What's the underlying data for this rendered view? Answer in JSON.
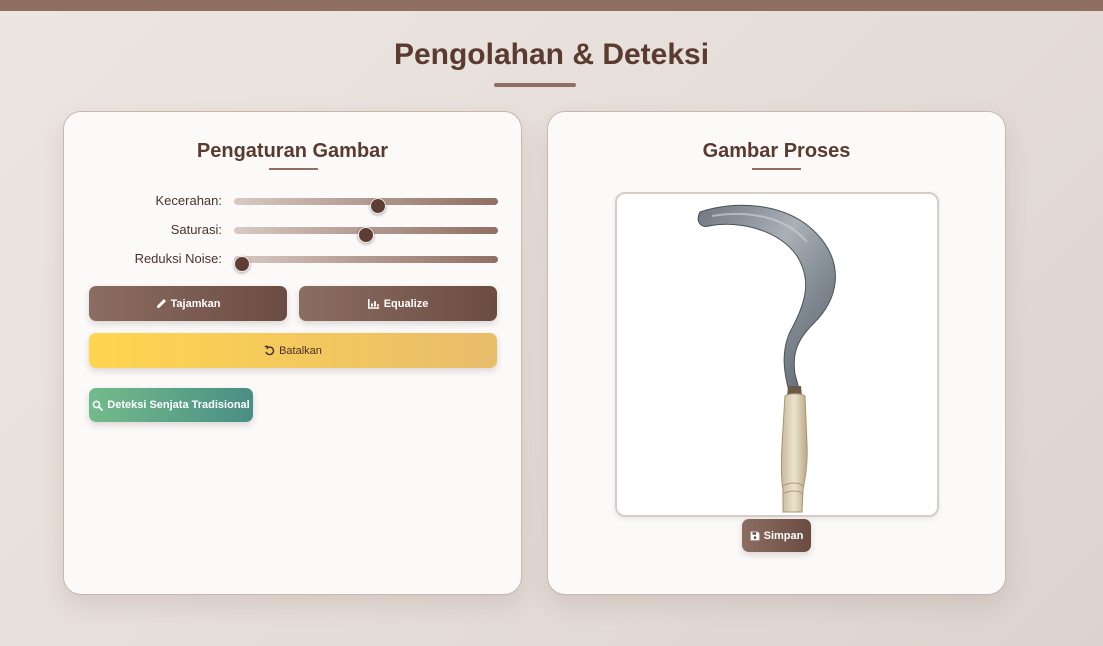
{
  "page": {
    "title": "Pengolahan & Deteksi"
  },
  "settings": {
    "title": "Pengaturan Gambar",
    "sliders": [
      {
        "label": "Kecerahan:",
        "value": 0.55
      },
      {
        "label": "Saturasi:",
        "value": 0.5
      },
      {
        "label": "Reduksi Noise:",
        "value": 0.0
      }
    ],
    "buttons": {
      "sharpen": "Tajamkan",
      "equalize": "Equalize",
      "undo": "Batalkan",
      "detect": "Deteksi Senjata Tradisional"
    }
  },
  "result": {
    "title": "Gambar Proses",
    "save": "Simpan"
  },
  "colors": {
    "accent": "#8f6f62",
    "dark_brown": "#5b3a30",
    "yellow": "#ffd54f",
    "teal": "#4a8e84"
  },
  "icons": {
    "sharpen": "pencil-icon",
    "equalize": "chart-icon",
    "undo": "undo-icon",
    "detect": "search-icon",
    "save": "floppy-icon"
  }
}
